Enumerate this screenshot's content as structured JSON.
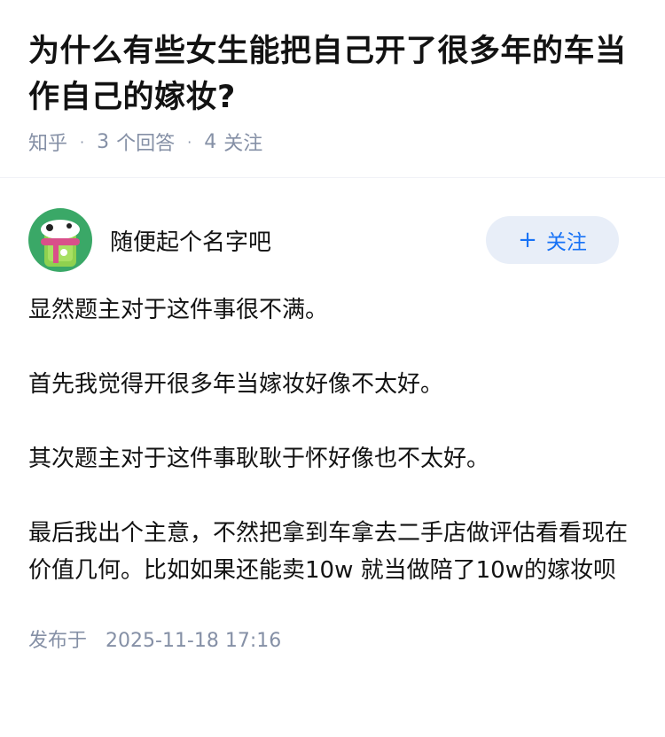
{
  "question": {
    "title": "为什么有些女生能把自己开了很多年的车当作自己的嫁妆?",
    "source": "知乎",
    "answers_count": "3",
    "answers_label": "个回答",
    "followers_count": "4",
    "followers_label": "关注"
  },
  "answer": {
    "author_name": "随便起个名字吧",
    "follow_label": "关注",
    "paragraphs": [
      "显然题主对于这件事很不满。",
      "首先我觉得开很多年当嫁妆好像不太好。",
      "其次题主对于这件事耿耿于怀好像也不太好。",
      "最后我出个主意，不然把拿到车拿去二手店做评估看看现在价值几何。比如如果还能卖10w 就当做陪了10w的嫁妆呗"
    ],
    "publish_label": "发布于",
    "publish_time": "2025-11-18 17:16"
  },
  "colors": {
    "accent": "#1772f6",
    "follow_bg": "#e8eef8",
    "meta": "#8590a6",
    "avatar_bg": "#3aa867"
  }
}
